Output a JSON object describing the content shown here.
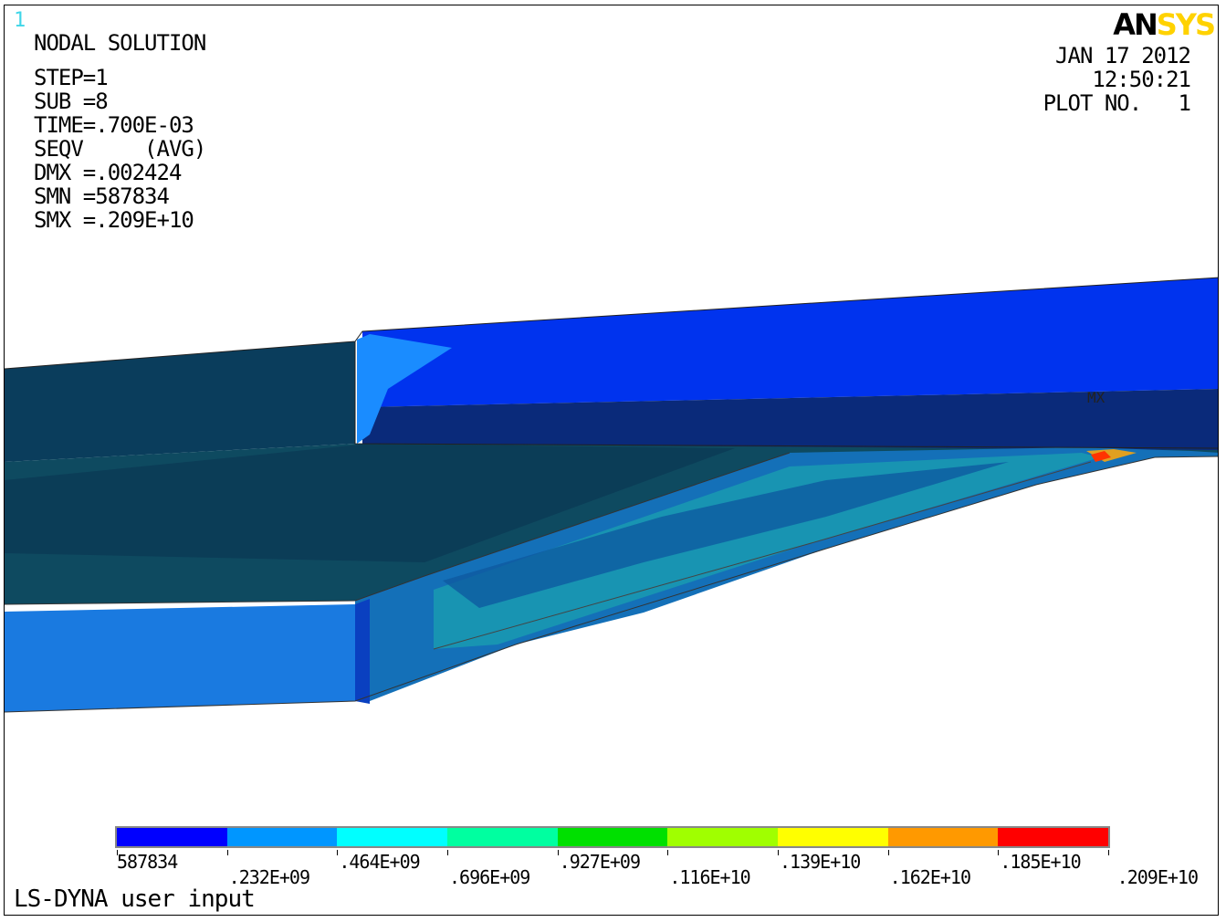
{
  "window_number": "1",
  "logo": {
    "part1": "AN",
    "part2": "SYS"
  },
  "info": {
    "title": "NODAL SOLUTION",
    "lines": [
      "STEP=1",
      "SUB =8",
      "TIME=.700E-03",
      "SEQV     (AVG)",
      "DMX =.002424",
      "SMN =587834",
      "SMX =.209E+10"
    ]
  },
  "header_right": {
    "date": "JAN 17 2012",
    "time": "12:50:21",
    "plot": "PLOT NO.   1"
  },
  "legend": {
    "colors": [
      "#0000ff",
      "#0096ff",
      "#00ffff",
      "#00ffa0",
      "#00e000",
      "#a0ff00",
      "#ffff00",
      "#ff9900",
      "#ff0000"
    ],
    "labels": [
      "587834",
      ".232E+09",
      ".464E+09",
      ".696E+09",
      ".927E+09",
      ".116E+10",
      ".139E+10",
      ".162E+10",
      ".185E+10",
      ".209E+10"
    ]
  },
  "model_labels": {
    "max_marker": "MX"
  },
  "footer": "LS-DYNA user input"
}
